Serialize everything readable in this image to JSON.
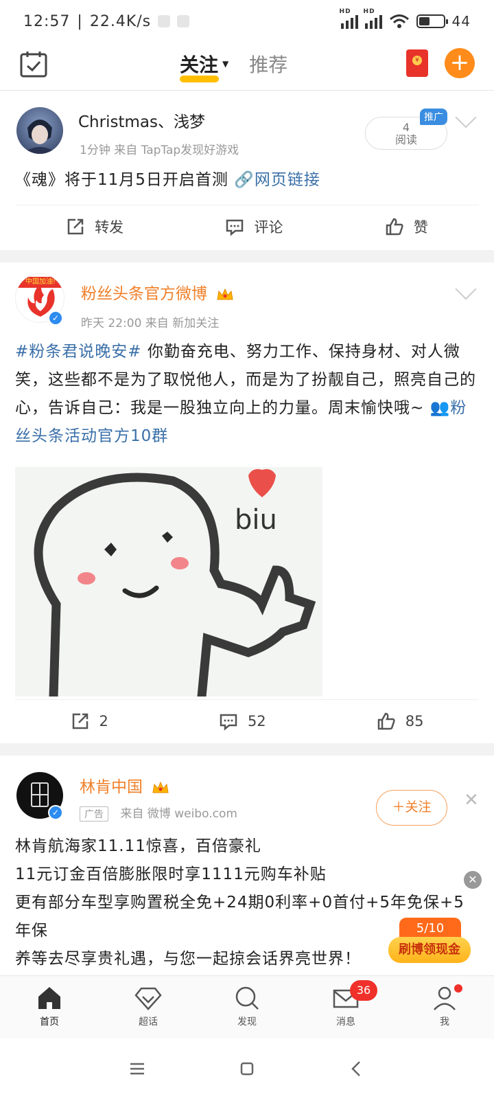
{
  "status_bar": {
    "time": "12:57",
    "speed": "22.4K/s",
    "battery": "44",
    "battery_level": 0.44
  },
  "top_nav": {
    "tabs": [
      {
        "label": "关注",
        "active": true
      },
      {
        "label": "推荐",
        "active": false
      }
    ]
  },
  "posts": [
    {
      "name": "Christmas、浅梦",
      "meta": "1分钟  来自 TapTap发现好游戏",
      "promo_badge": "推广",
      "reads_count": "4",
      "reads_label": "阅读",
      "text": "《魂》将于11月5日开启首测",
      "link_text": "网页链接",
      "actions": {
        "repost": "转发",
        "comment": "评论",
        "like": "赞"
      }
    },
    {
      "name": "粉丝头条官方微博",
      "meta": "昨天 22:00  来自 新加关注",
      "avatar_banner": "中国加油!",
      "hashtag": "#粉条君说晚安#",
      "text": "你勤奋充电、努力工作、保持身材、对人微笑，这些都不是为了取悦他人，而是为了扮靓自己，照亮自己的心，告诉自己：我是一股独立向上的力量。周末愉快哦~",
      "link_text": "粉丝头条活动官方10群",
      "image_caption": "biu",
      "actions": {
        "repost": "2",
        "comment": "52",
        "like": "85"
      }
    },
    {
      "name": "林肯中国",
      "ad_tag": "广告",
      "meta": "来自 微博 weibo.com",
      "follow": "关注",
      "lines": [
        "林肯航海家11.11惊喜，百倍豪礼",
        "11元订金百倍膨胀限时享1111元购车补贴",
        "更有部分车型享购置税全免+24期0利率+0首付+5年免保+5年保",
        "养等去尽享贵礼遇，与您一起掠会话界亮世界！"
      ]
    }
  ],
  "floating_promo": {
    "count": "5/10",
    "label": "刷博领现金"
  },
  "tab_bar": {
    "items": [
      {
        "label": "首页",
        "icon": "home-icon"
      },
      {
        "label": "超话",
        "icon": "diamond-icon"
      },
      {
        "label": "发现",
        "icon": "search-icon"
      },
      {
        "label": "消息",
        "icon": "mail-icon",
        "badge": "36"
      },
      {
        "label": "我",
        "icon": "person-icon"
      }
    ]
  },
  "colors": {
    "accent": "#ff8c1a",
    "link": "#3a6fa8",
    "tab_underline": "#ffbf00",
    "badge_red": "#f0302a"
  }
}
